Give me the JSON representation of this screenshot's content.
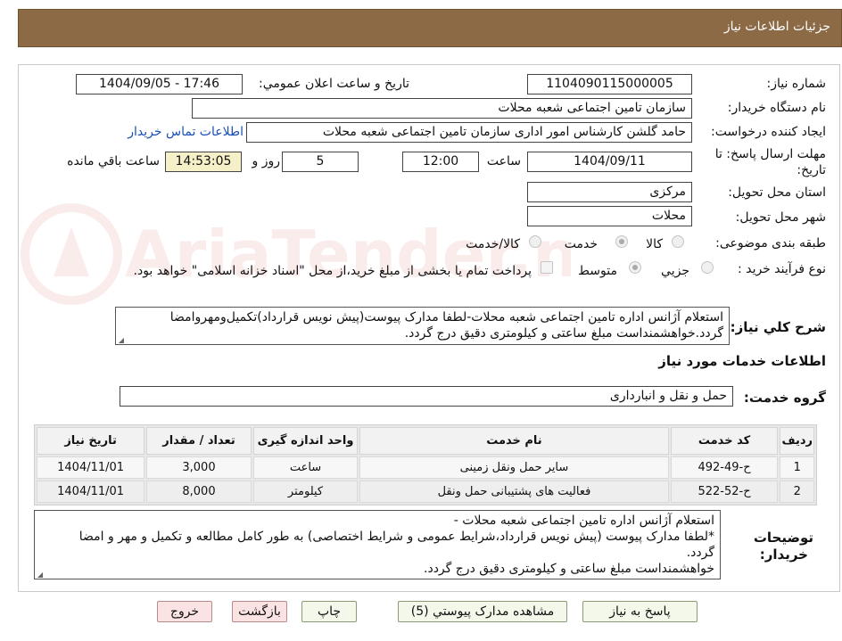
{
  "header": {
    "title": "جزئیات اطلاعات نیاز"
  },
  "fields": {
    "need_number": {
      "label": "شماره نیاز:",
      "value": "1104090115000005"
    },
    "announce": {
      "label": "تاریخ و ساعت اعلان عمومي:",
      "value": "1404/09/05 - 17:46"
    },
    "buyer_org": {
      "label": "نام دستگاه خريدار:",
      "value": "سازمان تامین اجتماعی شعبه محلات"
    },
    "requester": {
      "label": "ایجاد کننده درخواست:",
      "value": "حامد گلشن کارشناس امور اداری سازمان تامین اجتماعی شعبه محلات"
    },
    "contact_link": "اطلاعات تماس خريدار",
    "deadline": {
      "label_line1": "مهلت ارسال پاسخ: تا",
      "label_line2": "تاریخ:",
      "date": "1404/09/11",
      "time_label": "ساعت",
      "time": "12:00",
      "days": "5",
      "days_label": "روز و",
      "remaining": "14:53:05",
      "remaining_label": "ساعت باقي مانده"
    },
    "province": {
      "label": "استان محل تحویل:",
      "value": "مرکزی"
    },
    "city": {
      "label": "شهر محل تحویل:",
      "value": "محلات"
    },
    "category": {
      "label": "طبقه بندی موضوعی:",
      "options": [
        "کالا",
        "خدمت",
        "کالا/خدمت"
      ],
      "selected": "خدمت"
    },
    "process": {
      "label": "نوع فرآیند خرید :",
      "options": [
        "جزيي",
        "متوسط"
      ],
      "selected": "متوسط",
      "payment_note": "پرداخت تمام یا بخشی از مبلغ خرید،از محل \"اسناد خزانه اسلامی\" خواهد بود."
    }
  },
  "description": {
    "label": "شرح كلي نياز:",
    "text": "استعلام آژانس اداره تامین اجتماعی شعبه محلات-لطفا مدارک پیوست(پیش نویس قرارداد)تکمیل‌ومهروامضا گردد.خواهشمنداست مبلغ ساعتی و کیلومتری دقیق درج گردد."
  },
  "services": {
    "section_title": "اطلاعات خدمات مورد نياز",
    "group_label": "گروه خدمت:",
    "group_value": "حمل و نقل و انبارداری",
    "columns": [
      "رديف",
      "کد خدمت",
      "نام خدمت",
      "واحد اندازه گیری",
      "تعداد / مقدار",
      "تاریخ نیاز"
    ],
    "rows": [
      {
        "idx": "1",
        "code": "ح-49-492",
        "name": "سایر حمل ونقل زمینی",
        "unit": "ساعت",
        "qty": "3,000",
        "date": "1404/11/01"
      },
      {
        "idx": "2",
        "code": "ح-52-522",
        "name": "فعالیت های پشتیبانی حمل ونقل",
        "unit": "کیلومتر",
        "qty": "8,000",
        "date": "1404/11/01"
      }
    ]
  },
  "buyer_notes": {
    "label_line1": "توضیحات",
    "label_line2": "خریدار:",
    "lines": [
      "استعلام آژانس اداره تامین اجتماعی شعبه محلات -",
      "*لطفا مدارک پیوست (پیش نویس قرارداد،شرایط عمومی و شرایط اختصاصی) به طور کامل مطالعه و تکمیل و مهر و امضا",
      "گردد.",
      "خواهشمنداست مبلغ ساعتی و کیلومتری دقیق درج گردد."
    ]
  },
  "buttons": {
    "reply": "پاسخ به نیاز",
    "attachments": "مشاهده مدارک پیوستي (5)",
    "print": "چاپ",
    "back": "بازگشت",
    "exit": "خروج"
  },
  "watermark": "AriaTender.neT",
  "colors": {
    "header_bg": "#8b6a45",
    "highlight": "#f5f0c8",
    "link": "#1a4fb5"
  }
}
